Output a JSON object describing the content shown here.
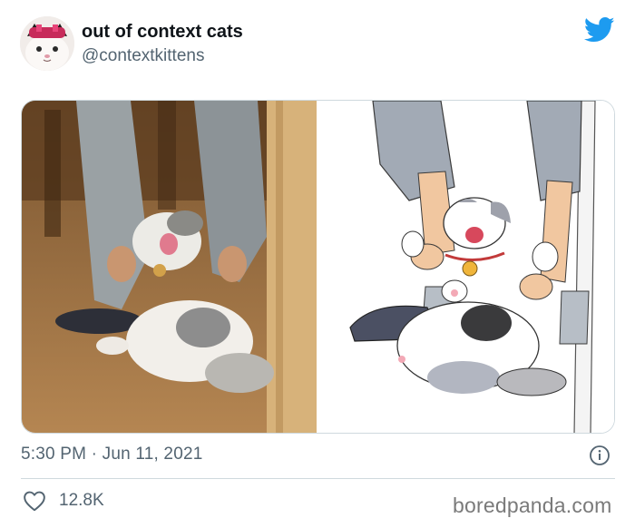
{
  "author": {
    "display_name": "out of context cats",
    "handle": "@contextkittens"
  },
  "icons": {
    "brand": "twitter-bird-icon",
    "info": "info-icon",
    "like": "heart-icon"
  },
  "tweet": {
    "timestamp": "5:30 PM · Jun 11, 2021",
    "like_count": "12.8K"
  },
  "watermark": "boredpanda.com",
  "colors": {
    "twitter_blue": "#1d9bf0",
    "secondary_text": "#536471",
    "divider": "#cfd9de"
  }
}
